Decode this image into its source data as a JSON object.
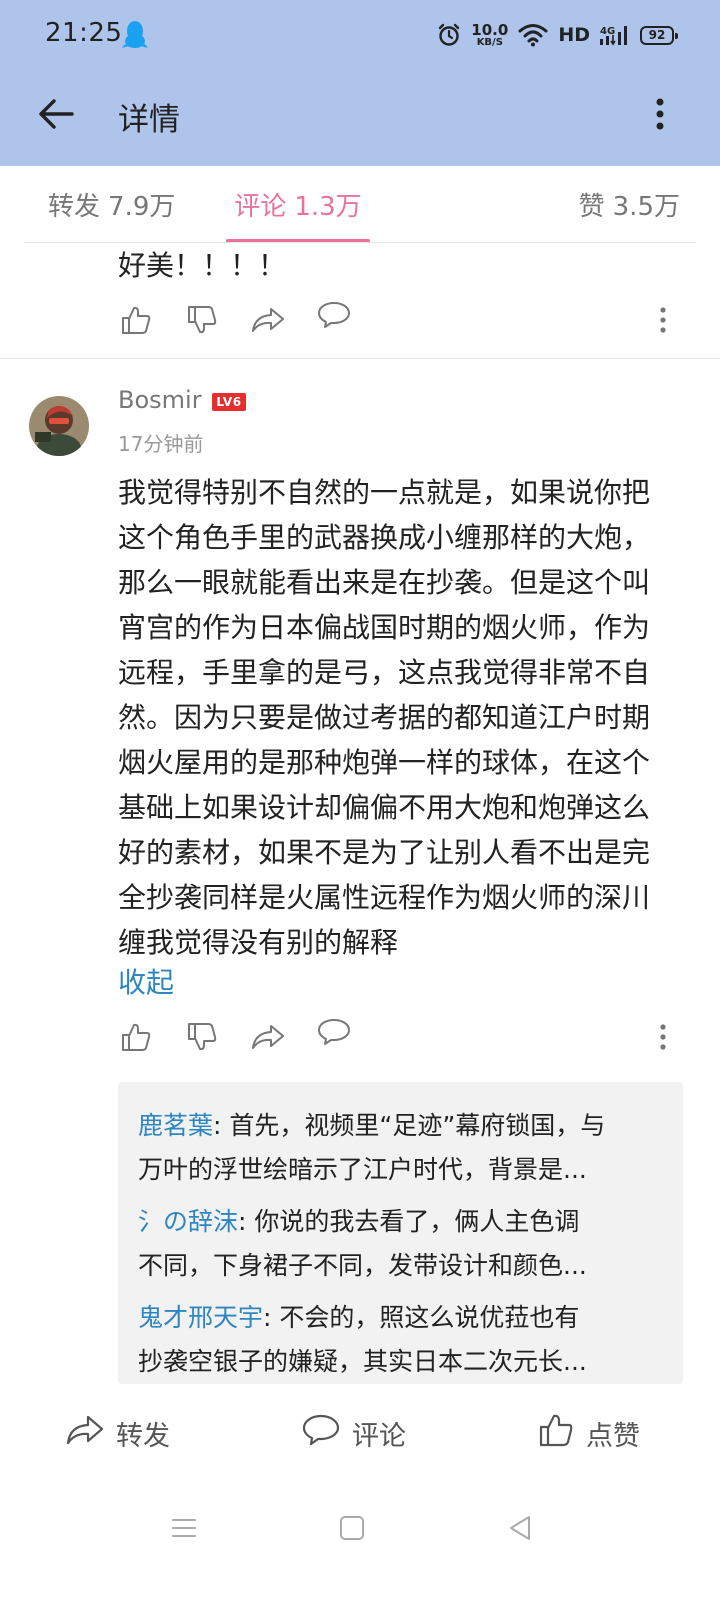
{
  "status_bar": {
    "time": "21:25",
    "net_speed_value": "10.0",
    "net_speed_unit": "KB/S",
    "hd_label": "HD",
    "signal_label": "4G",
    "battery": "92"
  },
  "header": {
    "title": "详情"
  },
  "tabs": [
    {
      "label": "转发",
      "count": "7.9万"
    },
    {
      "label": "评论",
      "count": "1.3万",
      "active": true
    },
    {
      "label": "赞",
      "count": "3.5万"
    }
  ],
  "comments": [
    {
      "text": "好美！！！！"
    },
    {
      "user": "Bosmir",
      "level": "LV6",
      "time": "17分钟前",
      "lines": [
        "我觉得特别不自然的一点就是，如果说你把",
        "这个角色手里的武器换成小缠那样的大炮，",
        "那么一眼就能看出来是在抄袭。但是这个叫",
        "宵宫的作为日本偏战国时期的烟火师，作为",
        "远程，手里拿的是弓，这点我觉得非常不自",
        "然。因为只要是做过考据的都知道江户时期",
        "烟火屋用的是那种炮弹一样的球体，在这个",
        "基础上如果设计却偏偏不用大炮和炮弹这么",
        "好的素材，如果不是为了让别人看不出是完",
        "全抄袭同样是火属性远程作为烟火师的深川",
        "缠我觉得没有别的解释"
      ],
      "collapse_label": "收起",
      "replies": [
        {
          "author": "鹿茗葉",
          "line1": ": 首先，视频里“足迹”幕府锁国，与",
          "line2": "万叶的浮世绘暗示了江户时代，背景是..."
        },
        {
          "author": "氵の辞沫",
          "line1": ": 你说的我去看了，俩人主色调",
          "line2": "不同，下身裙子不同，发带设计和颜色..."
        },
        {
          "author": "鬼才邢天宇",
          "line1": ": 不会的，照这么说优菈也有",
          "line2": "抄袭空银子的嫌疑，其实日本二次元长..."
        }
      ]
    }
  ],
  "bottom_bar": {
    "repost": "转发",
    "comment": "评论",
    "like": "点赞"
  },
  "colors": {
    "header_bg": "#aec4ea",
    "tab_active": "#e8749a",
    "link_blue": "#2e86c0",
    "level_badge": "#e52e2e"
  },
  "icons": [
    "qq-icon",
    "alarm-icon",
    "wifi-icon",
    "signal-icon",
    "back-arrow-icon",
    "more-vertical-icon",
    "thumb-up-icon",
    "thumb-down-icon",
    "share-icon",
    "comment-bubble-icon"
  ]
}
